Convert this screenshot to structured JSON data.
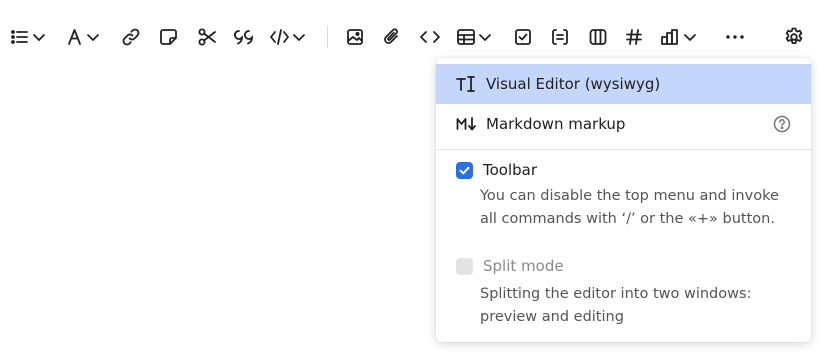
{
  "toolbar": {
    "icons": [
      "list-icon",
      "text-style-icon",
      "link-icon",
      "note-icon",
      "cut-icon",
      "quote-icon",
      "code-block-icon",
      "image-icon",
      "attachment-icon",
      "inline-code-icon",
      "table-icon",
      "checkbox-icon",
      "form-icon",
      "columns-icon",
      "hash-icon",
      "chart-icon",
      "more-icon",
      "settings-icon"
    ]
  },
  "menu": {
    "modes": [
      {
        "label": "Visual Editor (wysiwyg)",
        "icon": "text-cursor-icon",
        "selected": true
      },
      {
        "label": "Markdown markup",
        "icon": "markdown-icon",
        "selected": false
      }
    ],
    "toolbar_option": {
      "title": "Toolbar",
      "checked": true,
      "description": "You can disable the top menu and invoke all commands with ‘/’ or the «+» button."
    },
    "split_option": {
      "title": "Split mode",
      "checked": false,
      "disabled": true,
      "description": "Splitting the editor into two windows: preview and editing"
    }
  },
  "colors": {
    "selected_bg": "#c4d7fa",
    "checkbox_on": "#2e6fe0",
    "checkbox_off": "#e4e4e4"
  }
}
